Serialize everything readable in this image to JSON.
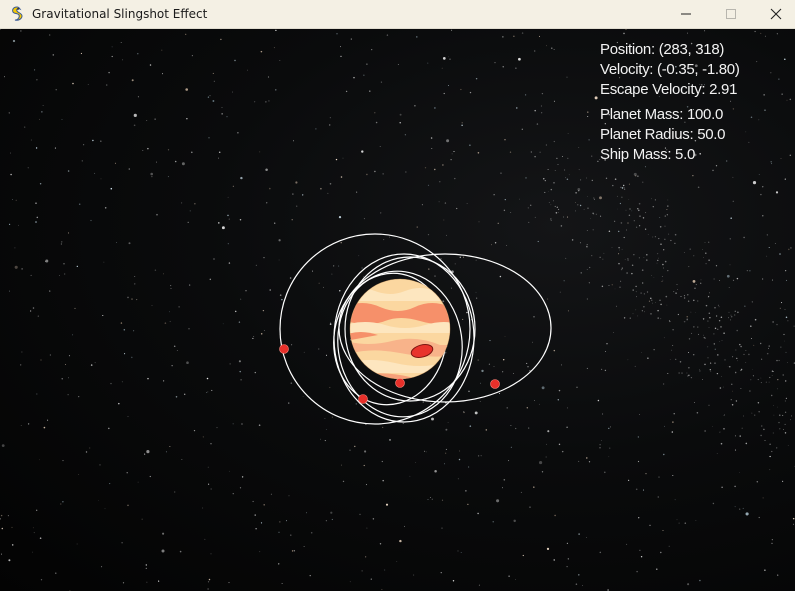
{
  "window": {
    "title": "Gravitational Slingshot Effect",
    "app_icon": "pygame-snake-icon",
    "controls": {
      "minimize_icon": "minimize-icon",
      "maximize_icon": "maximize-icon",
      "close_icon": "close-icon"
    }
  },
  "hud": {
    "position": "Position: (283, 318)",
    "velocity": "Velocity: (-0.35, -1.80)",
    "escape_velocity": "Escape Velocity: 2.91",
    "planet_mass": "Planet Mass: 100.0",
    "planet_radius": "Planet Radius: 50.0",
    "ship_mass": "Ship Mass: 5.0"
  },
  "scene": {
    "background": "starfield",
    "planet": {
      "name": "gas-giant-planet",
      "colors": {
        "base": "#fbd7a0",
        "band_dark": "#f6906a",
        "band_light": "#fde6bf",
        "spot": "#e8342c"
      }
    },
    "orbit_color": "#ffffff",
    "ship_color": "#e8302a",
    "ship_count": 4
  }
}
